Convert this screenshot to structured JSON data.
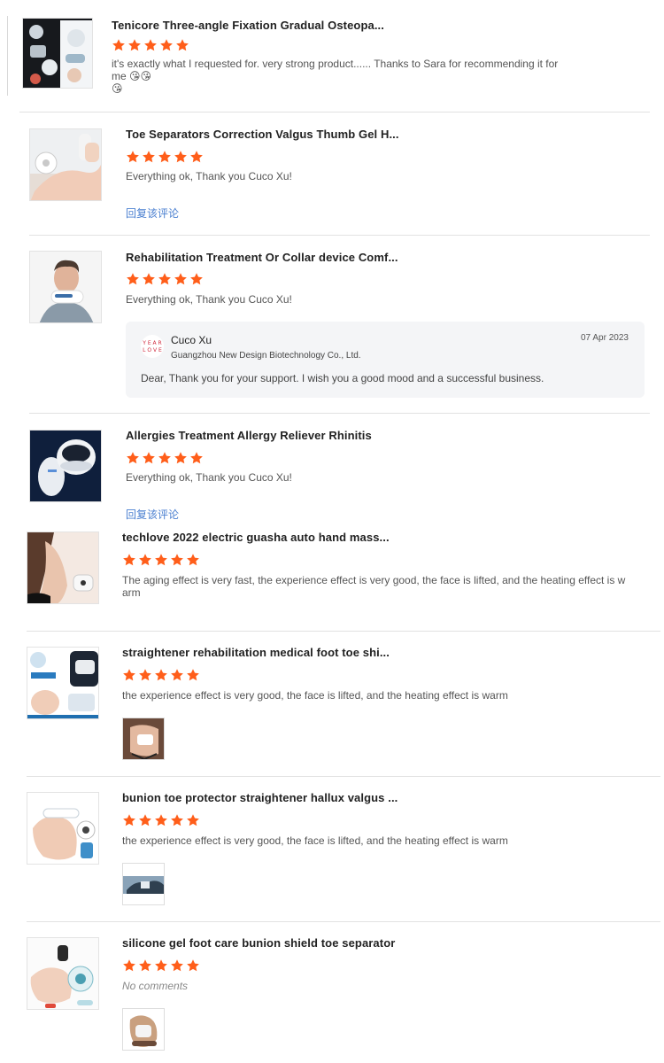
{
  "colors": {
    "star": "#ff5e1a",
    "link": "#4a7fd0",
    "divider": "#e2e2e2"
  },
  "reviews": [
    {
      "title": "Tenicore Three-angle Fixation Gradual Osteopa...",
      "rating": 5,
      "comment_line1": "it's exactly what I requested for. very strong product...... Thanks to Sara for recommending it for me 😘😘",
      "comment_line2": "😘"
    },
    {
      "title": "Toe Separators Correction Valgus Thumb Gel H...",
      "rating": 5,
      "comment": "Everything ok, Thank you Cuco Xu!",
      "reply_link": "回复该评论"
    },
    {
      "title": "Rehabilitation Treatment Or Collar device Comf...",
      "rating": 5,
      "comment": "Everything ok, Thank you Cuco Xu!",
      "seller_reply": {
        "logo_text": "YEAR LOVE",
        "name": "Cuco Xu",
        "company": "Guangzhou New Design Biotechnology Co., Ltd.",
        "date": "07 Apr 2023",
        "message": "Dear, Thank you for your support. I wish you a good mood and a successful business."
      }
    },
    {
      "title": "Allergies Treatment Allergy Reliever Rhinitis",
      "rating": 5,
      "comment": "Everything ok, Thank you Cuco Xu!",
      "reply_link": "回复该评论"
    },
    {
      "title": "techlove 2022 electric guasha auto hand mass...",
      "rating": 5,
      "comment_line1": "The aging effect is very fast, the experience effect is very good, the face is lifted, and the heating effect is w",
      "comment_line2": "arm"
    },
    {
      "title": "straightener rehabilitation medical foot toe shi...",
      "rating": 5,
      "comment": "the experience effect is very good, the face is lifted, and the heating effect is warm"
    },
    {
      "title": "bunion toe protector straightener hallux valgus ...",
      "rating": 5,
      "comment": "the experience effect is very good, the face is lifted, and the heating effect is warm"
    },
    {
      "title": "silicone gel foot care bunion shield toe separator",
      "rating": 5,
      "comment": "No comments"
    }
  ]
}
